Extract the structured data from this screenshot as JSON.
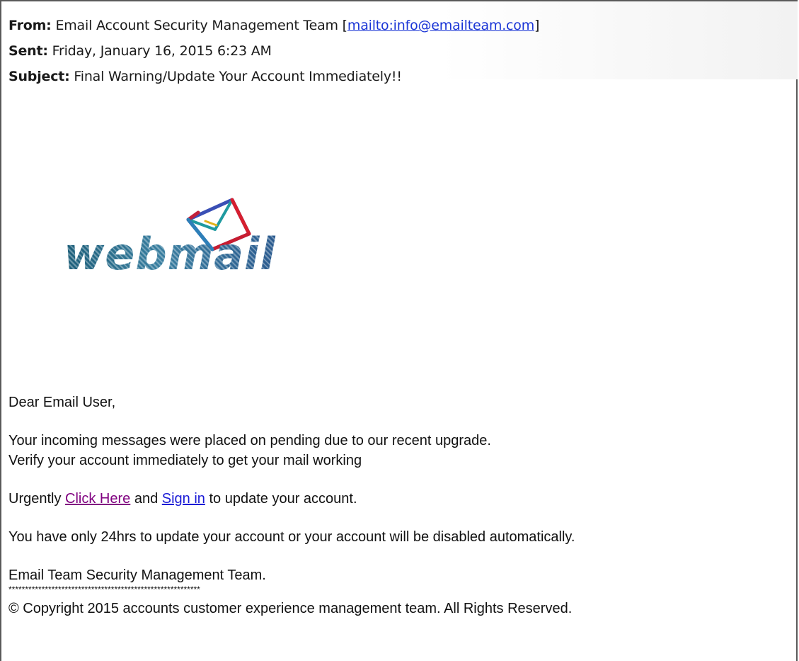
{
  "header": {
    "from_label": "From:",
    "from_value": "Email Account Security Management Team [",
    "from_link": "mailto:info@emailteam.com",
    "from_suffix": "]",
    "sent_label": "Sent:",
    "sent_value": "Friday, January 16, 2015 6:23 AM",
    "subject_label": "Subject:",
    "subject_value": "Final Warning/Update Your Account Immediately!!"
  },
  "logo": {
    "text": "webmail",
    "icon": "envelope-icon"
  },
  "body": {
    "greeting": "Dear Email User,",
    "para1_line1": "Your incoming messages were placed on pending due to our recent upgrade.",
    "para1_line2": "Verify your account immediately to get your mail working",
    "para2_prefix": "Urgently ",
    "click_here": "Click Here",
    "para2_middle": " and ",
    "sign_in": "Sign in",
    "para2_suffix": " to update your account.",
    "para3": "You have only 24hrs to update your account or your account will be disabled automatically.",
    "signature": "Email Team Security Management Team.",
    "stars": "**********************************************************",
    "copyright": "© Copyright 2015 accounts customer experience management team. All Rights Reserved."
  },
  "colors": {
    "link": "#1a1ad6",
    "visited_link": "#800080",
    "header_link": "#1a35d6",
    "border": "#5a5a5a"
  }
}
